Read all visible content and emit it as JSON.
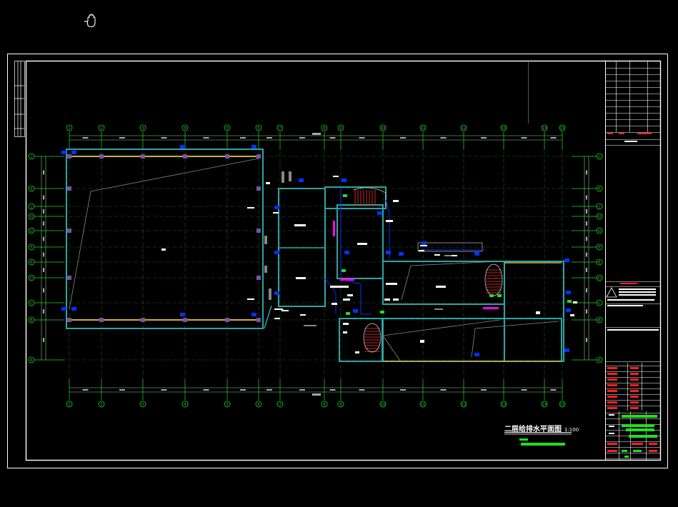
{
  "drawing": {
    "title": "二层给排水平面图",
    "scale": "1:100",
    "columns_top": [
      "1",
      "2",
      "3",
      "4",
      "5",
      "6",
      "7",
      "8",
      "9",
      "10",
      "11",
      "12",
      "13",
      "14",
      "15"
    ],
    "columns_bottom": [
      "1",
      "2",
      "3",
      "4",
      "5",
      "6",
      "7",
      "8",
      "9",
      "10",
      "11",
      "12",
      "13",
      "14",
      "15"
    ],
    "rows_left": [
      "L",
      "K",
      "J",
      "H",
      "G",
      "F",
      "E",
      "D",
      "C",
      "B",
      "A"
    ],
    "rows_right": [
      "L",
      "K",
      "J",
      "H",
      "G",
      "F",
      "E",
      "D",
      "C",
      "B",
      "A"
    ]
  },
  "colors": {
    "background": "#000000",
    "frame": "#ffffff",
    "grid_bubble": "#22cc22",
    "wall": "#2fa3a3",
    "pipe_supply": "#0033ff",
    "pipe_drain": "#ff00ff",
    "stairs": "#ff3333",
    "dim_line": "#8fd18f",
    "annotation": "#ffffff",
    "title_block_red": "#ff2020",
    "title_block_green": "#22dd22"
  },
  "icons": {
    "cursor": "pan-hand-icon"
  }
}
